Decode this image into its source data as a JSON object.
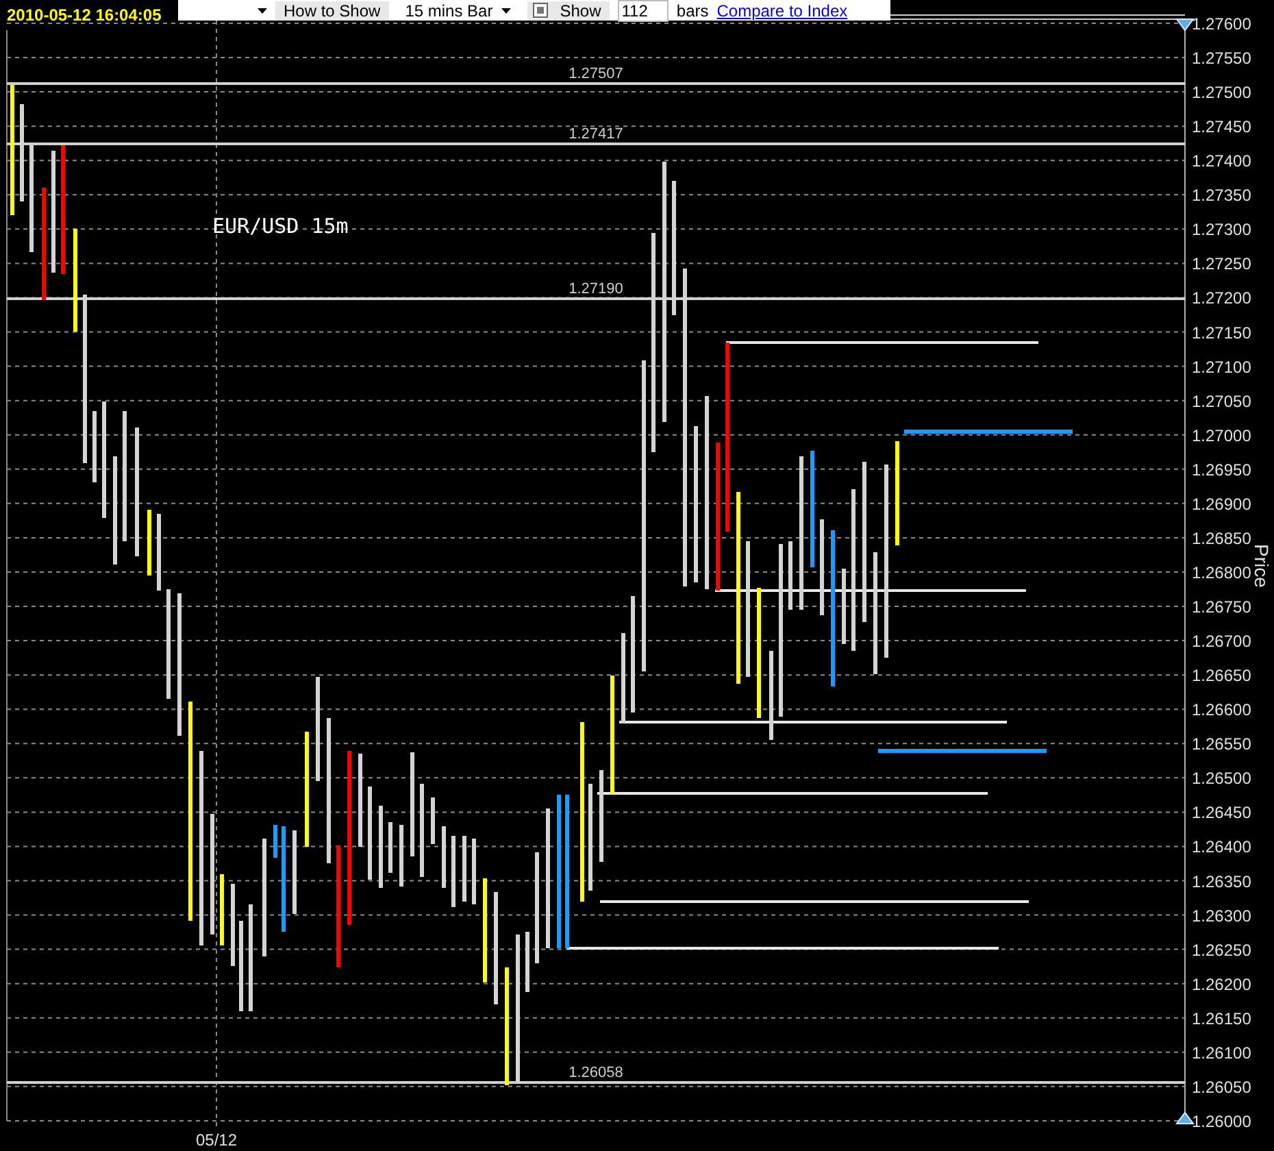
{
  "timestamp": "2010-05-12 16:04:05",
  "toolbar": {
    "show_as_label": "How to Show",
    "interval": "15 mins Bar",
    "show": {
      "label": "Show",
      "checked": true
    },
    "bar_count": "112",
    "bars_label": "bars",
    "compare_link": "Compare to Index"
  },
  "chart": {
    "title": "EUR/USD 15m",
    "y_axis_title": "Price",
    "y_ticks": [
      "1.27600",
      "1.27550",
      "1.27500",
      "1.27450",
      "1.27400",
      "1.27350",
      "1.27300",
      "1.27250",
      "1.27200",
      "1.27150",
      "1.27100",
      "1.27050",
      "1.27000",
      "1.26950",
      "1.26900",
      "1.26850",
      "1.26800",
      "1.26750",
      "1.26700",
      "1.26650",
      "1.26600",
      "1.26550",
      "1.26500",
      "1.26450",
      "1.26400",
      "1.26350",
      "1.26300",
      "1.26250",
      "1.26200",
      "1.26150",
      "1.26100",
      "1.26050",
      "1.26000"
    ],
    "x_labels": [
      "05/12"
    ],
    "levels": [
      {
        "label": "1.27507"
      },
      {
        "label": "1.27417"
      },
      {
        "label": "1.27190"
      },
      {
        "label": "1.26058"
      }
    ]
  }
}
